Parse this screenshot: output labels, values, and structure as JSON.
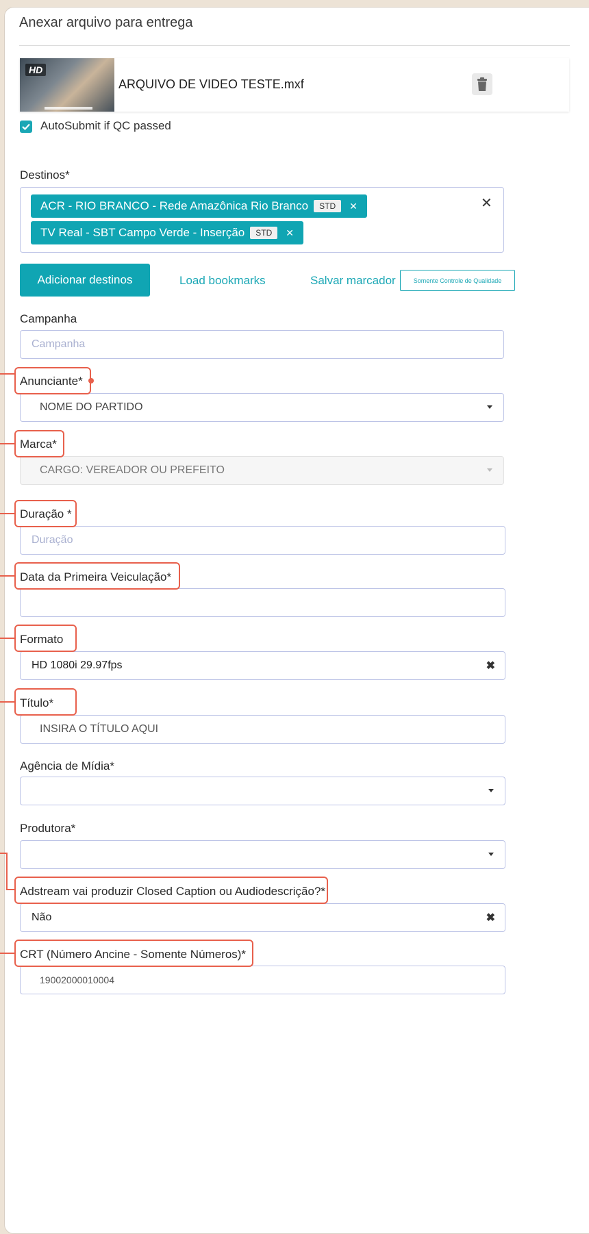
{
  "section_title": "Anexar arquivo para entrega",
  "file": {
    "thumb_badge": "HD",
    "name": "ARQUIVO DE VIDEO TESTE.mxf"
  },
  "autosubmit": {
    "label": "AutoSubmit if QC passed",
    "checked": true
  },
  "destinos": {
    "label": "Destinos*",
    "tags": [
      {
        "name": "ACR - RIO BRANCO - Rede Amazônica Rio Branco",
        "badge": "STD"
      },
      {
        "name": "TV Real - SBT Campo Verde - Inserção",
        "badge": "STD"
      }
    ]
  },
  "actions": {
    "add_destinations": "Adicionar destinos",
    "load_bookmarks": "Load bookmarks",
    "save_bookmark": "Salvar marcador",
    "qc_only": "Somente Controle de Qualidade"
  },
  "fields": {
    "campanha": {
      "label": "Campanha",
      "placeholder": "Campanha"
    },
    "anunciante": {
      "label": "Anunciante*",
      "value": "NOME DO PARTIDO"
    },
    "marca": {
      "label": "Marca*",
      "value": "CARGO: VEREADOR OU PREFEITO"
    },
    "duracao": {
      "label": "Duração *",
      "placeholder": "Duração"
    },
    "data_veiculacao": {
      "label": "Data da Primeira Veiculação*",
      "value": ""
    },
    "formato": {
      "label": "Formato",
      "value": "HD 1080i 29.97fps"
    },
    "titulo": {
      "label": "Título*",
      "value": "INSIRA O TÍTULO AQUI"
    },
    "agencia": {
      "label": "Agência de Mídia*",
      "value": ""
    },
    "produtora": {
      "label": "Produtora*",
      "value": ""
    },
    "closed_caption": {
      "label": "Adstream vai produzir Closed Caption ou Audiodescrição?*",
      "value": "Não"
    },
    "crt": {
      "label": "CRT (Número Ancine - Somente Números)*",
      "value": "19002000010004"
    }
  },
  "colors": {
    "accent": "#10a5b3",
    "highlight": "#e8604c",
    "input_border": "#bcc3e6"
  }
}
